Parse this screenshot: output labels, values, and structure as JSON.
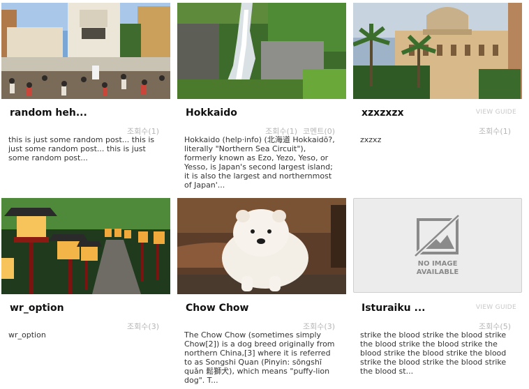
{
  "posts": [
    {
      "title": "random heh...",
      "guide": "",
      "meta": [
        "조회수(1)"
      ],
      "excerpt": "this is just some random post... this is just some random post... this is just some random post..."
    },
    {
      "title": "Hokkaido",
      "guide": "",
      "meta": [
        "조회수(1)",
        "코멘트(0)"
      ],
      "excerpt": "Hokkaido (help·info) (北海道 Hokkaidō?, literally \"Northern Sea Circuit\"), formerly known as Ezo, Yezo, Yeso, or Yesso, is Japan's second largest island; it is also the largest and northernmost of Japan'..."
    },
    {
      "title": "xzxzxzx",
      "guide": "VIEW GUIDE",
      "meta": [
        "조회수(1)"
      ],
      "excerpt": "zxzxz"
    },
    {
      "title": "wr_option",
      "guide": "",
      "meta": [
        "조회수(3)"
      ],
      "excerpt": "wr_option"
    },
    {
      "title": "Chow Chow",
      "guide": "",
      "meta": [
        "조회수(3)"
      ],
      "excerpt": "The Chow Chow (sometimes simply Chow[2]) is a dog breed originally from northern China,[3] where it is referred to as Songshi Quan (Pinyin: sōngshī quǎn 鬆獅犬), which means \"puffy-lion dog\". T..."
    },
    {
      "title": "Isturaiku ...",
      "guide": "VIEW GUIDE",
      "meta": [
        "조회수(5)"
      ],
      "excerpt": "strike the blood strike the blood strike the blood strike the blood strike the blood strike the blood strike the blood strike the blood strike the blood strike the blood st..."
    }
  ],
  "no_image": {
    "line1": "NO IMAGE",
    "line2": "AVAILABLE"
  }
}
